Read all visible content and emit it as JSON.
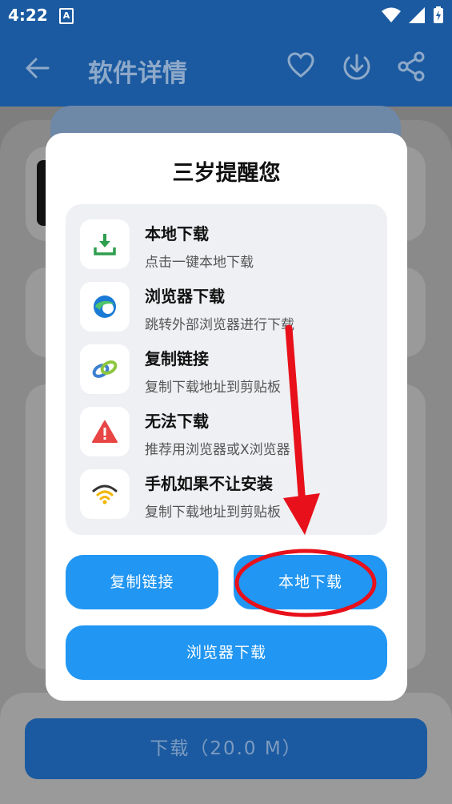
{
  "status_bar": {
    "time": "4:22",
    "notification": "A"
  },
  "app_bar": {
    "title": "软件详情"
  },
  "dialog": {
    "title": "三岁提醒您",
    "options": [
      {
        "title": "本地下载",
        "subtitle": "点击一键本地下载",
        "icon": "download-icon"
      },
      {
        "title": "浏览器下载",
        "subtitle": "跳转外部浏览器进行下载",
        "icon": "edge-browser-icon"
      },
      {
        "title": "复制链接",
        "subtitle": "复制下载地址到剪贴板",
        "icon": "link-icon"
      },
      {
        "title": "无法下载",
        "subtitle": "推荐用浏览器或X浏览器",
        "icon": "warning-icon"
      },
      {
        "title": "手机如果不让安装",
        "subtitle": "复制下载地址到剪贴板",
        "icon": "wifi-icon"
      }
    ],
    "buttons": {
      "copy_link": "复制链接",
      "local_download": "本地下载",
      "browser_download": "浏览器下载"
    }
  },
  "download_button": {
    "label": "下载（20.0 M）"
  },
  "colors": {
    "primary_blue": "#2196f3",
    "app_bar": "#1b5aa0",
    "annotation_red": "#e8101a"
  }
}
